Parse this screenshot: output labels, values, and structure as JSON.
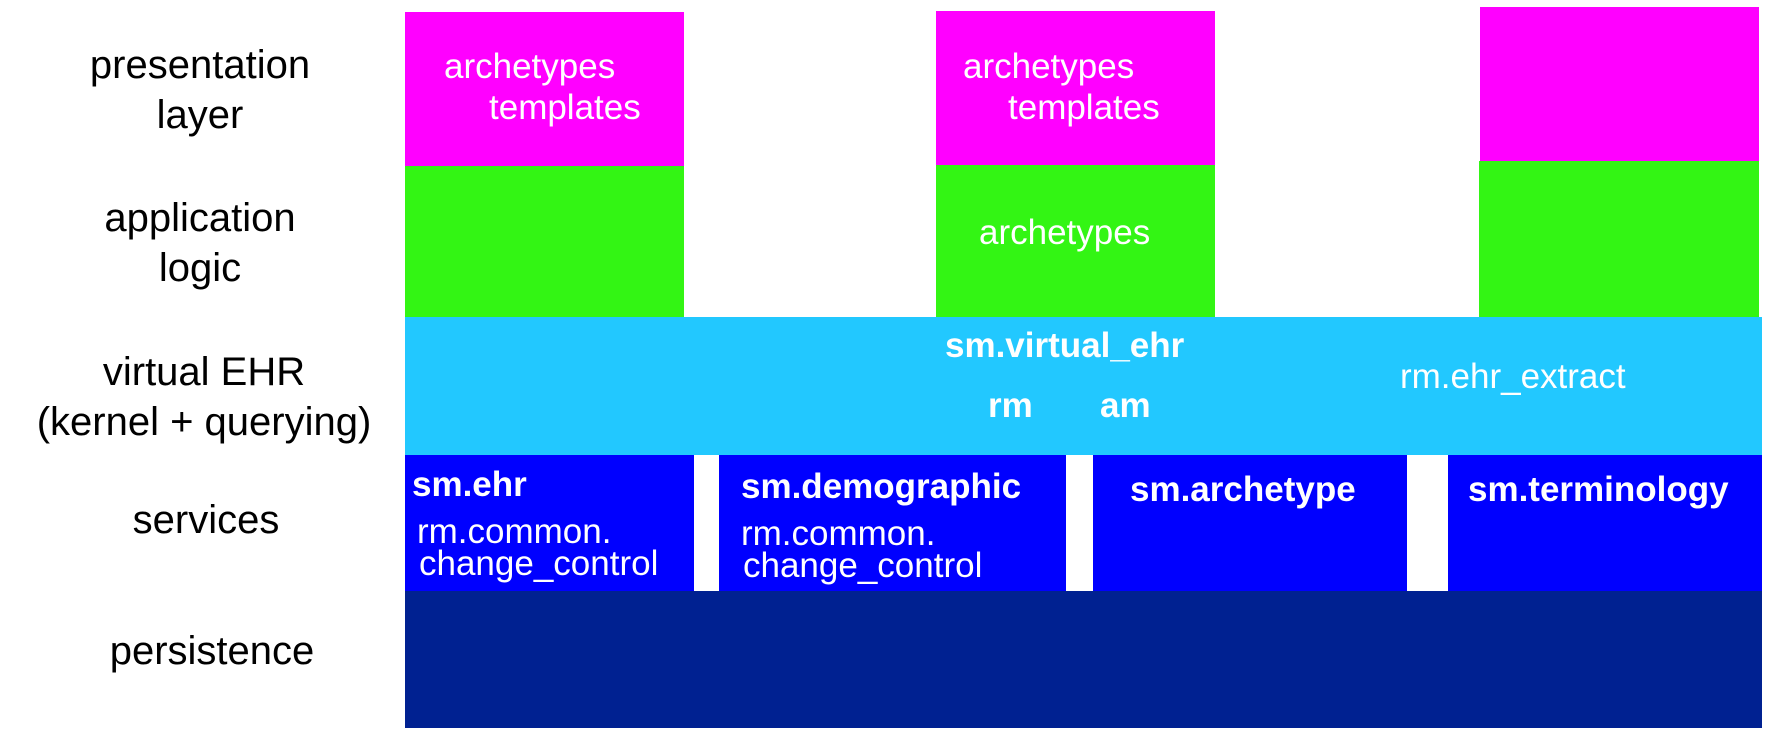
{
  "layers": {
    "presentation": "presentation\nlayer",
    "application": "application\nlogic",
    "virtual_ehr": "virtual EHR\n(kernel + querying)",
    "services": "services",
    "persistence": "persistence"
  },
  "colors": {
    "presentation": "#ff00ff",
    "application": "#33f514",
    "virtual_ehr": "#22c8ff",
    "services": "#0000ff",
    "persistence": "#002191"
  },
  "columns": [
    {
      "presentation_line1": "archetypes",
      "presentation_line2": "templates",
      "application": ""
    },
    {
      "presentation_line1": "archetypes",
      "presentation_line2": "templates",
      "application": "archetypes"
    },
    {
      "presentation_line1": "",
      "presentation_line2": "",
      "application": ""
    }
  ],
  "virtual_ehr": {
    "main": "sm.virtual_ehr",
    "rm": "rm",
    "am": "am",
    "extract": "rm.ehr_extract"
  },
  "services": [
    {
      "title": "sm.ehr",
      "sub1": "rm.common.",
      "sub2": "change_control"
    },
    {
      "title": "sm.demographic",
      "sub1": "rm.common.",
      "sub2": "change_control"
    },
    {
      "title": "sm.archetype"
    },
    {
      "title": "sm.terminology"
    }
  ]
}
